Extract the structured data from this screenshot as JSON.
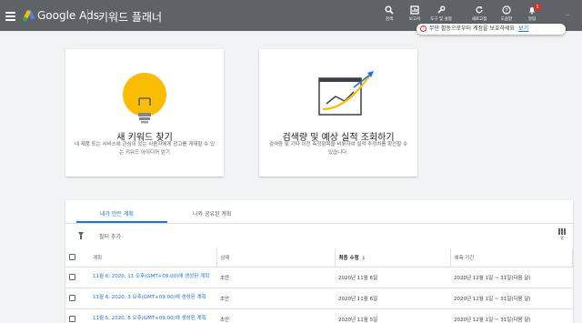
{
  "header": {
    "brand": "Google Ads",
    "tool_title": "키워드 플래너",
    "toolbar": [
      {
        "label": "검색",
        "icon": "search-icon"
      },
      {
        "label": "보고서",
        "icon": "reports-icon"
      },
      {
        "label": "도구 및 설정",
        "icon": "wrench-icon"
      },
      {
        "label": "새로고침",
        "icon": "refresh-icon"
      },
      {
        "label": "도움말",
        "icon": "help-icon"
      },
      {
        "label": "알림",
        "icon": "bell-icon",
        "badge": "1"
      }
    ],
    "account": "...",
    "notice": {
      "text": "무단 활동으로부터 계정을 보호하세요",
      "link": "보기"
    }
  },
  "cards": [
    {
      "title": "새 키워드 찾기",
      "description": "내 제품 또는 서비스에 관심이 있는 사용자에게 광고를 게재할 수 있는 키워드 아이디어 얻기",
      "icon": "lightbulb-icon"
    },
    {
      "title": "검색량 및 예상 실적 조회하기",
      "description": "검색량 및 기타 이전 측정항목을 비롯하여 실적 추정치를 확인할 수 있습니다.",
      "icon": "trend-chart-icon"
    }
  ],
  "plans": {
    "tabs": [
      "내가 만든 계획",
      "나와 공유된 계획"
    ],
    "filter_label": "필터 추가",
    "columns_label": "열",
    "columns": [
      "계획",
      "상태",
      "최종 수정",
      "예측 기간"
    ],
    "rows": [
      {
        "name": "11월 6, 2020, 11 오후(GMT+09:00)에 생성된 계획",
        "status": "초안",
        "modified": "2020년 11월 6일",
        "period": "2020년 12월 1일 ~ 31일(다음 달)"
      },
      {
        "name": "11월 6, 2020, 3 오후(GMT+09:00)에 생성된 계획",
        "status": "초안",
        "modified": "2020년 11월 6일",
        "period": "2020년 12월 1일 ~ 31일(다음 달)"
      },
      {
        "name": "11월 5, 2020, 8 오후(GMT+09:00)에 생성된 계획",
        "status": "초안",
        "modified": "2020년 11월 5일",
        "period": "2020년 12월 1일 ~ 31일(다음 달)"
      }
    ]
  },
  "colors": {
    "header_bg": "#5f6368",
    "accent": "#1a73e8",
    "bulb": "#fbbc04",
    "alert": "#d93025"
  }
}
